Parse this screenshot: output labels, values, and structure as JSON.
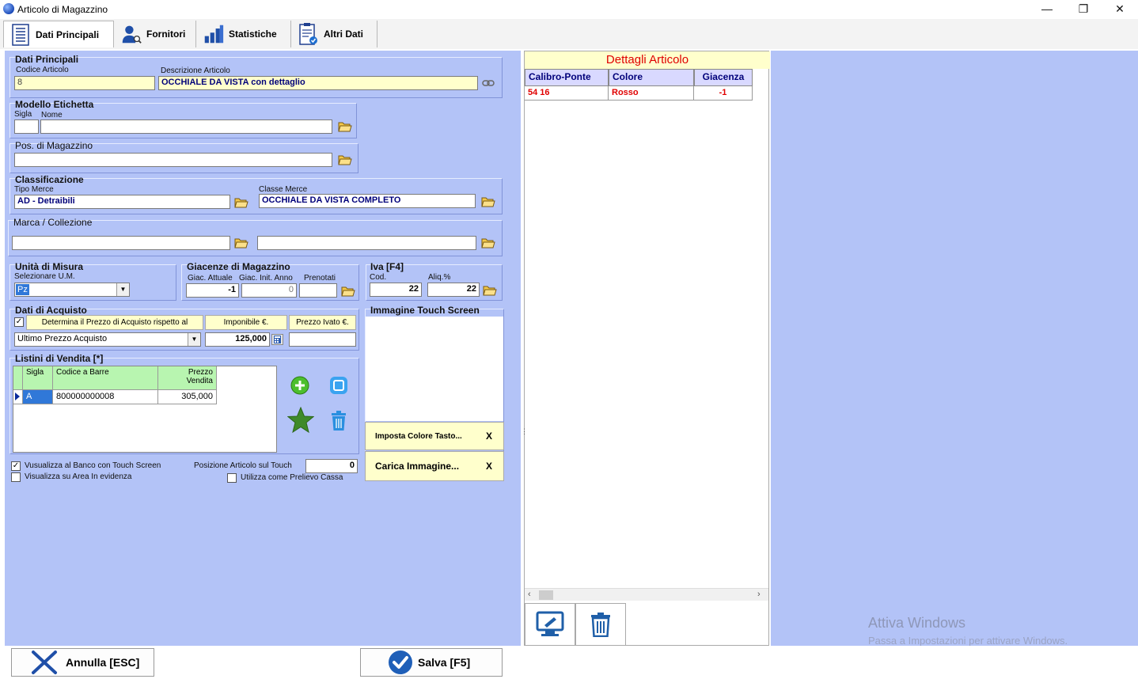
{
  "window": {
    "title": "Articolo di Magazzino",
    "minimize": "—",
    "restore": "❐",
    "close": "✕"
  },
  "tabs": [
    {
      "label": "Dati Principali",
      "icon": "list-icon"
    },
    {
      "label": "Fornitori",
      "icon": "user-search-icon"
    },
    {
      "label": "Statistiche",
      "icon": "stats-bars-icon"
    },
    {
      "label": "Altri Dati",
      "icon": "clipboard-check-icon"
    }
  ],
  "dati_principali": {
    "title": "Dati Principali",
    "codice_label": "Codice Articolo",
    "codice_value": "8",
    "descrizione_label": "Descrizione Articolo",
    "descrizione_value": "OCCHIALE DA VISTA con dettaglio"
  },
  "modello_etichetta": {
    "title": "Modello Etichetta",
    "sigla_label": "Sigla",
    "nome_label": "Nome",
    "sigla_value": "",
    "nome_value": ""
  },
  "pos_magazzino": {
    "title": "Pos. di Magazzino",
    "value": ""
  },
  "classificazione": {
    "title": "Classificazione",
    "tipo_label": "Tipo Merce",
    "tipo_value": "AD - Detraibili",
    "classe_label": "Classe Merce",
    "classe_value": "OCCHIALE DA VISTA COMPLETO"
  },
  "marca": {
    "title": "Marca / Collezione",
    "marca_value": "",
    "collezione_value": ""
  },
  "unita": {
    "title": "Unità di Misura",
    "label": "Selezionare U.M.",
    "value": "Pz"
  },
  "giacenze": {
    "title": "Giacenze di Magazzino",
    "attuale_label": "Giac. Attuale",
    "init_label": "Giac. Init. Anno",
    "prenotati_label": "Prenotati",
    "attuale": "-1",
    "init": "0",
    "prenotati": ""
  },
  "iva": {
    "title": "Iva [F4]",
    "cod_label": "Cod.",
    "aliq_label": "Aliq.%",
    "cod": "22",
    "aliq": "22"
  },
  "acquisto": {
    "title": "Dati di Acquisto",
    "determina_label": "Determina il Prezzo di Acquisto rispetto al",
    "determina_checked": "✓",
    "imponibile_label": "Imponibile €.",
    "ivato_label": "Prezzo Ivato €.",
    "tipo_value": "Ultimo Prezzo Acquisto",
    "imponibile": "125,000",
    "ivato": ""
  },
  "listini": {
    "title": "Listini di Vendita [*]",
    "headers": [
      "Sigla",
      "Codice a Barre",
      "Prezzo Vendita"
    ],
    "rows": [
      {
        "sigla": "A",
        "barcode": "800000000008",
        "prezzo": "305,000"
      }
    ]
  },
  "touch": {
    "title": "Immagine Touch Screen",
    "imposta_colore": "Imposta Colore Tasto...",
    "carica_immagine": "Carica Immagine...",
    "x_label": "X"
  },
  "options": {
    "visualizza_banco": "Vusualizza al Banco con Touch Screen",
    "visualizza_banco_checked": "✓",
    "visualizza_area": "Visualizza su Area In evidenza",
    "posizione_label": "Posizione Articolo sul Touch",
    "posizione_value": "0",
    "prelievo_label": "Utilizza come Prelievo Cassa"
  },
  "dettagli": {
    "title": "Dettagli Articolo",
    "headers": [
      "Calibro-Ponte",
      "Colore",
      "Giacenza"
    ],
    "rows": [
      {
        "calibro": "54 16",
        "colore": "Rosso",
        "giacenza": "-1"
      }
    ]
  },
  "buttons": {
    "annulla": "Annulla [ESC]",
    "salva": "Salva [F5]"
  },
  "watermark": {
    "line1": "Attiva Windows",
    "line2": "Passa a Impostazioni per attivare Windows."
  }
}
